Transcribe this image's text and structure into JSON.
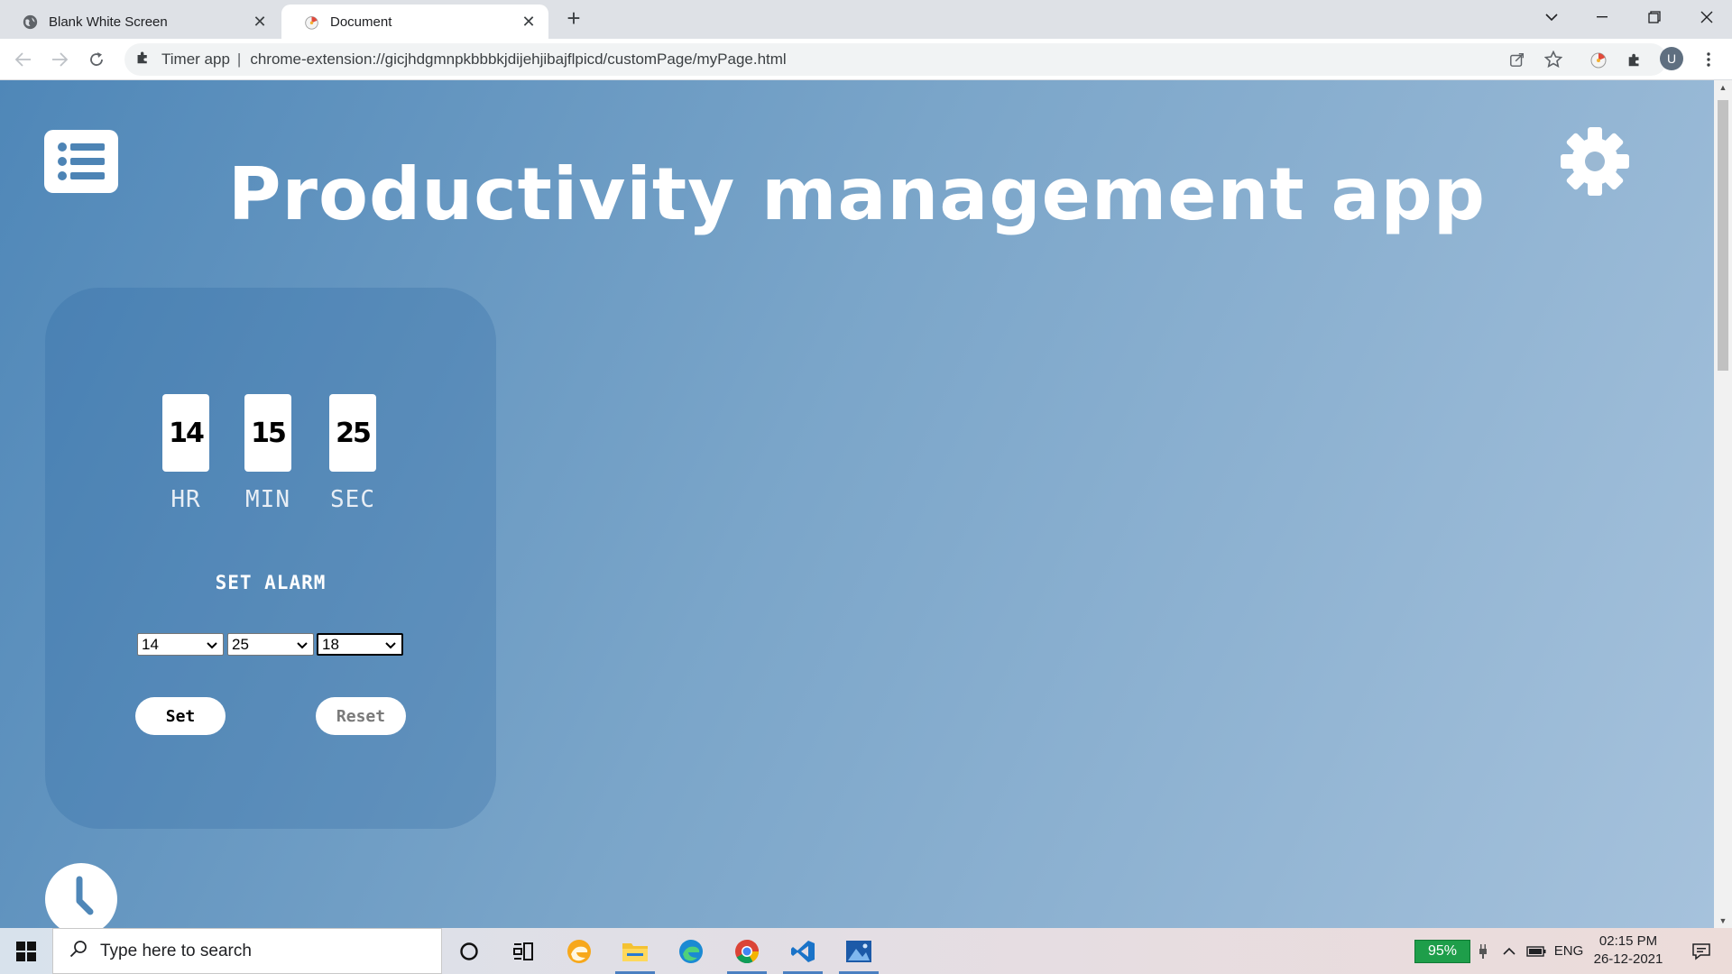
{
  "browser": {
    "tabs": [
      {
        "title": "Blank White Screen",
        "active": false
      },
      {
        "title": "Document",
        "active": true
      }
    ],
    "omnibox": {
      "extension_name": "Timer app",
      "separator": "|",
      "url": "chrome-extension://gicjhdgmnpkbbbkjdijehjibajflpicd/customPage/myPage.html"
    },
    "profile_initial": "U"
  },
  "page": {
    "title": "Productivity management app",
    "timer": {
      "hours": "14",
      "minutes": "15",
      "seconds": "25",
      "hours_label": "HR",
      "minutes_label": "MIN",
      "seconds_label": "SEC"
    },
    "alarm": {
      "heading": "SET ALARM",
      "hour_value": "14",
      "minute_value": "25",
      "second_value": "18",
      "set_label": "Set",
      "reset_label": "Reset"
    }
  },
  "taskbar": {
    "search_placeholder": "Type here to search",
    "battery_percent": "95%",
    "language": "ENG",
    "time": "02:15 PM",
    "date": "26-12-2021"
  },
  "colors": {
    "gradient_start": "#4f87b8",
    "gradient_end": "#a6c2dc",
    "battery_green": "#1e9e4a",
    "reset_text": "#7a7a7a"
  }
}
